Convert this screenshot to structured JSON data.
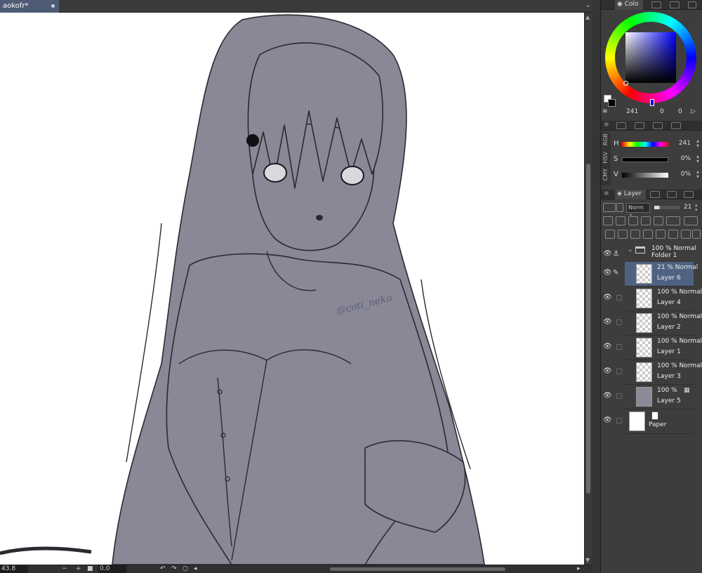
{
  "document": {
    "tab_title": "aokofr*"
  },
  "canvas": {
    "watermark": "@coti_neko"
  },
  "status": {
    "zoom": "43.8",
    "rotation": "0.0"
  },
  "color_panel": {
    "tab_label": "Colo",
    "hue_value": "241",
    "sat_value": "0",
    "val_value": "0",
    "fg_color": "#ffffff",
    "bg_color": "#000000"
  },
  "sliders": {
    "modes": [
      "RGB",
      "HSV",
      "CMY"
    ],
    "rows": [
      {
        "label": "H",
        "value": "241"
      },
      {
        "label": "S",
        "value": "0%"
      },
      {
        "label": "V",
        "value": "0%"
      }
    ]
  },
  "layer_panel": {
    "tab_label": "Layer",
    "blend_mode": "Norm",
    "opacity": "21"
  },
  "layers": [
    {
      "meta": "100 % Normal",
      "name": "Folder 1"
    },
    {
      "meta": "21 % Normal",
      "name": "Layer 6"
    },
    {
      "meta": "100 % Normal",
      "name": "Layer 4"
    },
    {
      "meta": "100 % Normal",
      "name": "Layer 2"
    },
    {
      "meta": "100 % Normal",
      "name": "Layer 1"
    },
    {
      "meta": "100 % Normal",
      "name": "Layer 3"
    },
    {
      "meta": "100 %",
      "name": "Layer 5"
    },
    {
      "meta": "",
      "name": "Paper"
    }
  ]
}
